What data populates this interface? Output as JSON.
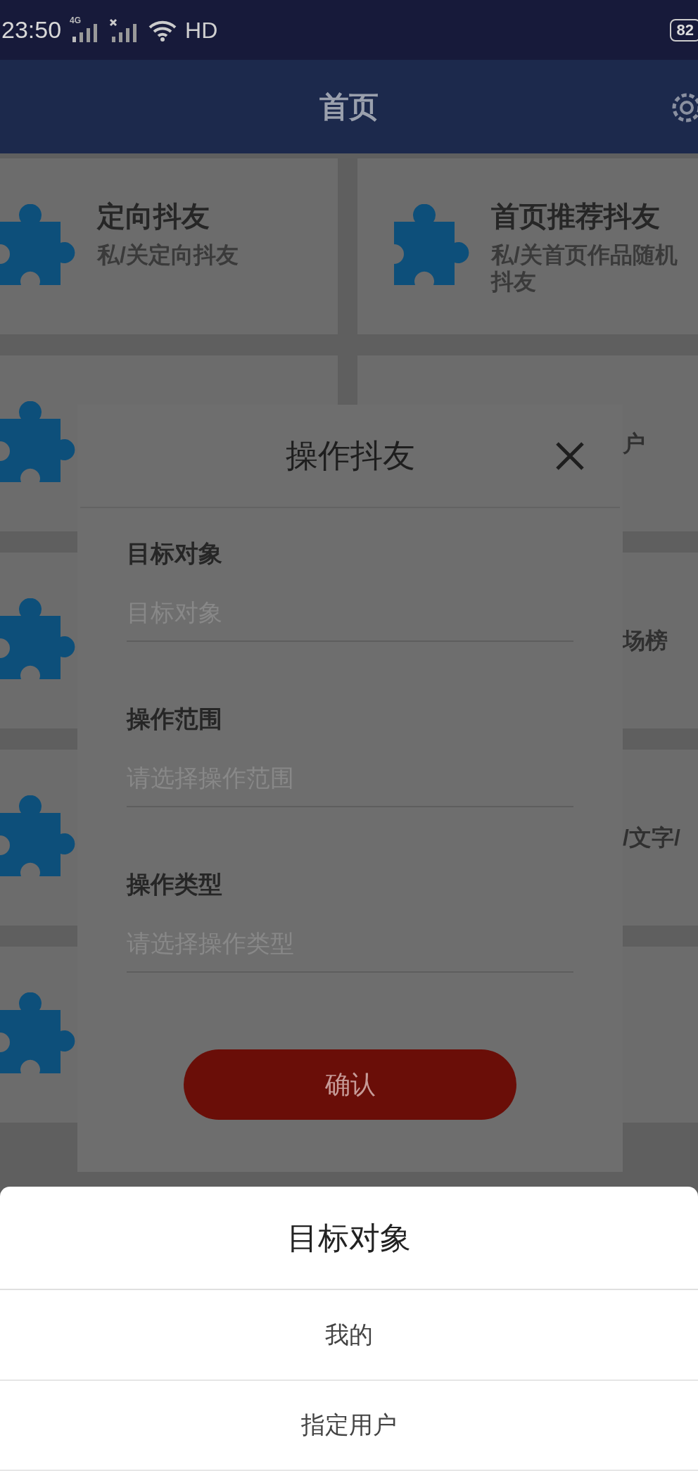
{
  "status_bar": {
    "time": "23:50",
    "network": "4G",
    "hd": "HD",
    "battery": "82"
  },
  "header": {
    "title": "首页"
  },
  "rows": [
    {
      "left": {
        "kind": "plugin",
        "title": "定向抖友",
        "subtitle": "私/关定向抖友"
      },
      "right": {
        "kind": "plugin",
        "title": "首页推荐抖友",
        "subtitle": "私/关首页作品随机抖友"
      }
    },
    {
      "left": {
        "kind": "plugin"
      },
      "right": {
        "kind": "partial",
        "text": "户"
      }
    },
    {
      "left": {
        "kind": "plugin"
      },
      "right": {
        "kind": "partial",
        "text": "场榜"
      }
    },
    {
      "left": {
        "kind": "plugin"
      },
      "right": {
        "kind": "partial",
        "text": "/文字/"
      }
    },
    {
      "left": {
        "kind": "plugin"
      },
      "right": {
        "kind": "partial"
      }
    }
  ],
  "dialog": {
    "title": "操作抖友",
    "fields": [
      {
        "label": "目标对象",
        "placeholder": "目标对象"
      },
      {
        "label": "操作范围",
        "placeholder": "请选择操作范围"
      },
      {
        "label": "操作类型",
        "placeholder": "请选择操作类型"
      }
    ],
    "confirm": "确认"
  },
  "sheet": {
    "title": "目标对象",
    "options": [
      "我的",
      "指定用户"
    ]
  }
}
